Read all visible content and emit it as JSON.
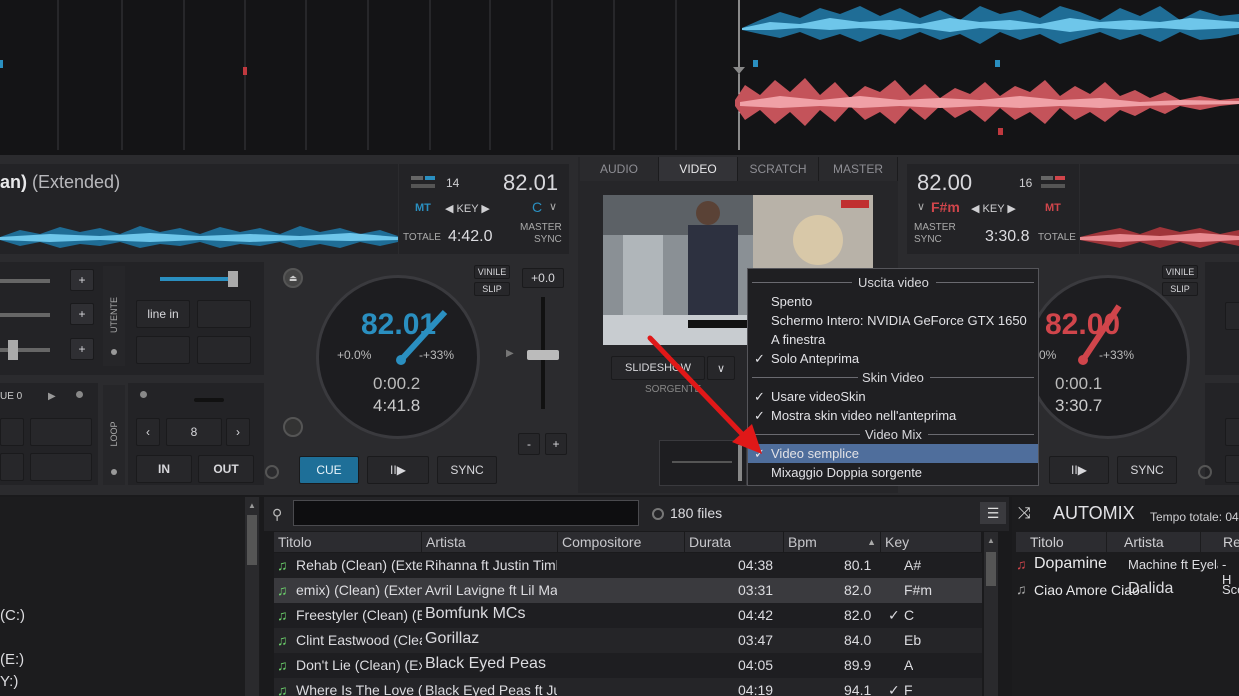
{
  "deck_left": {
    "title_bold": "an)",
    "title_rest": "(Extended)",
    "pitch_num": "14",
    "bpm": "82.01",
    "mt": "MT",
    "key_label": "KEY",
    "key_value": "C",
    "total_label": "TOTALE",
    "total_time": "4:42.0",
    "master_label": "MASTER",
    "sync_label": "SYNC",
    "jog_bpm": "82.01",
    "pitch_pct": "+0.0%",
    "range_pct": "-+33%",
    "elapsed": "0:00.2",
    "remaining": "4:41.8",
    "vinile": "VINILE",
    "slip": "SLIP",
    "pitch_readout": "+0.0",
    "cue": "CUE",
    "play": "II▶",
    "sync": "SYNC",
    "utente": "UTENTE",
    "line_in": "line in",
    "loop": "LOOP",
    "loop_size": "8",
    "loop_in": "IN",
    "loop_out": "OUT",
    "cue_label": "UE 0",
    "minus": "-",
    "plus": "+"
  },
  "deck_right": {
    "bpm": "82.00",
    "pitch_num": "16",
    "key_value": "F#m",
    "key_label": "KEY",
    "mt": "MT",
    "master_label": "MASTER",
    "sync_label": "SYNC",
    "total_time": "3:30.8",
    "total_label": "TOTALE",
    "jog_bpm": "82.00",
    "pitch_pct": "0%",
    "range_pct": "-+33%",
    "elapsed": "0:00.1",
    "remaining": "3:30.7",
    "vinile": "VINILE",
    "slip": "SLIP",
    "play": "II▶",
    "sync": "SYNC"
  },
  "center": {
    "tabs": [
      "AUDIO",
      "VIDEO",
      "SCRATCH",
      "MASTER"
    ],
    "active_tab": "VIDEO",
    "slideshow": "SLIDESHOW",
    "source": "SORGENTE"
  },
  "menu": {
    "sections": [
      {
        "header": "Uscita video",
        "items": [
          {
            "label": "Spento",
            "checked": false
          },
          {
            "label": "Schermo Intero: NVIDIA GeForce GTX 1650",
            "checked": false
          },
          {
            "label": "A finestra",
            "checked": false
          },
          {
            "label": "Solo Anteprima",
            "checked": true
          }
        ]
      },
      {
        "header": "Skin Video",
        "items": [
          {
            "label": "Usare videoSkin",
            "checked": true
          },
          {
            "label": "Mostra skin video nell'anteprima",
            "checked": true
          }
        ]
      },
      {
        "header": "Video Mix",
        "items": [
          {
            "label": "Video semplice",
            "checked": true,
            "highlighted": true
          },
          {
            "label": "Mixaggio Doppia sorgente",
            "checked": false
          }
        ]
      }
    ]
  },
  "sidebar": {
    "items": [
      "(C:)",
      "(E:)",
      "Y:)"
    ]
  },
  "browser": {
    "search_value": "",
    "file_count": "180 files",
    "columns": [
      "Titolo",
      "Artista",
      "Compositore",
      "Durata",
      "Bpm",
      "Key"
    ],
    "rows": [
      {
        "title": "Rehab (Clean) (Exten...",
        "artist": "Rihanna ft Justin Timb...",
        "duration": "04:38",
        "bpm": "80.1",
        "key": "A#",
        "mark": ""
      },
      {
        "title": "emix) (Clean) (Extended)",
        "artist": "Avril Lavigne ft Lil Mama",
        "duration": "03:31",
        "bpm": "82.0",
        "key": "F#m",
        "mark": ""
      },
      {
        "title": "Freestyler (Clean) (Ex...",
        "artist": "Bomfunk MCs",
        "duration": "04:42",
        "bpm": "82.0",
        "key": "C",
        "mark": "✓"
      },
      {
        "title": "Clint Eastwood (Clea...",
        "artist": "Gorillaz",
        "duration": "03:47",
        "bpm": "84.0",
        "key": "Eb",
        "mark": ""
      },
      {
        "title": "Don't Lie (Clean) (Ext...",
        "artist": "Black Eyed Peas",
        "duration": "04:05",
        "bpm": "89.9",
        "key": "A",
        "mark": ""
      },
      {
        "title": "Where Is The Love (C...",
        "artist": "Black Eyed Peas ft Jus...",
        "duration": "04:19",
        "bpm": "94.1",
        "key": "F",
        "mark": "✓"
      }
    ]
  },
  "automix": {
    "title": "AUTOMIX",
    "total_label": "Tempo totale: 04",
    "columns": [
      "Titolo",
      "Artista",
      "Re"
    ],
    "rows": [
      {
        "title": "Dopamine",
        "artist": "Machine ft Eyelar",
        "extra": "- H"
      },
      {
        "title": "Ciao Amore Ciao",
        "artist": "Dalida",
        "extra": "Sco"
      }
    ]
  },
  "colors": {
    "deck_left": "#2a8fc0",
    "deck_right": "#d0454b",
    "menu_highlight": "#4f6e9c"
  }
}
